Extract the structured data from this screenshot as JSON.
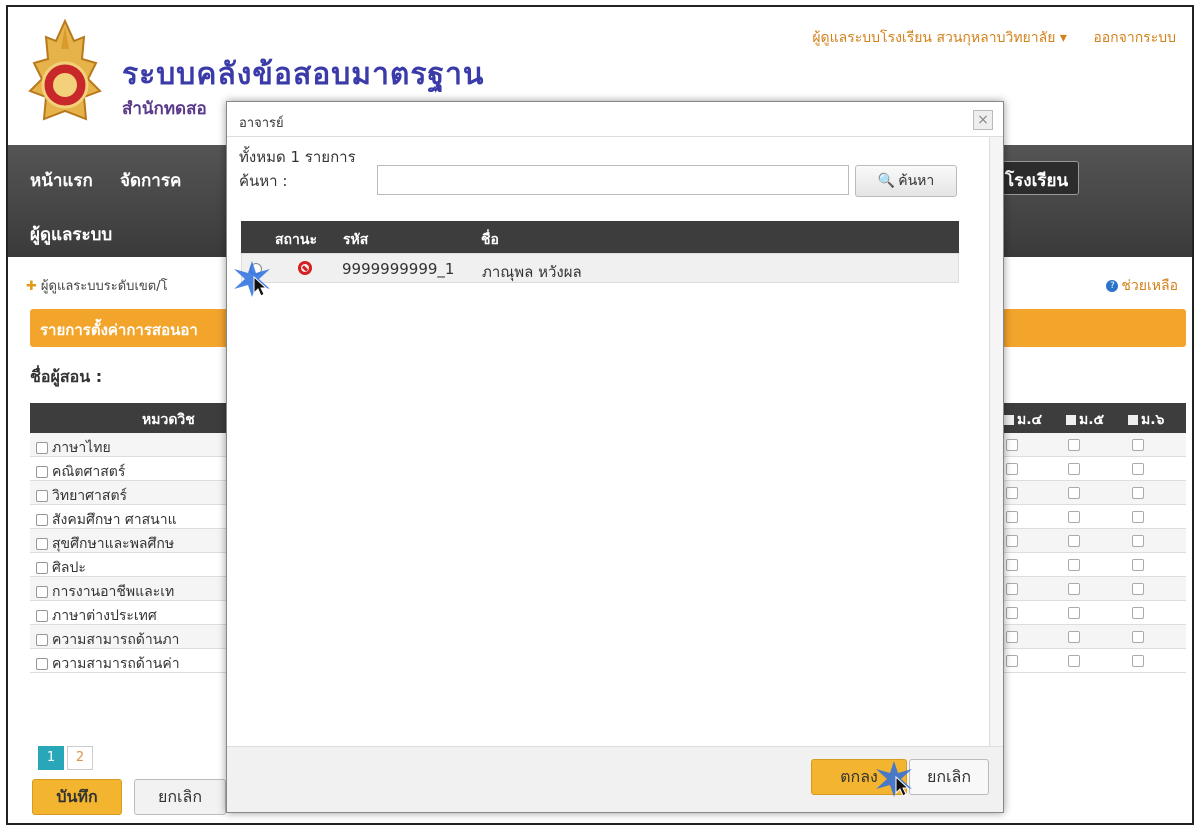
{
  "header": {
    "title": "ระบบคลังข้อสอบมาตรฐาน",
    "subtitle": "สำนักทดสอ",
    "user_menu": "ผู้ดูแลระบบโรงเรียน สวนกุหลาบวิทยาลัย ▾",
    "logout": "ออกจากระบบ"
  },
  "nav": {
    "items": [
      "หน้าแรก",
      "จัดการค",
      "ผู้ดูแลระบบ"
    ],
    "school_button": "โรงเรียน"
  },
  "breadcrumb": "ผู้ดูแลระบบระดับเขต/โ",
  "help": "ช่วยเหลือ",
  "section_title": "รายการตั้งค่าการสอนอา",
  "teacher_label": "ชื่อผู้สอน :",
  "grid": {
    "subject_header": "หมวดวิช",
    "level_headers": [
      "ม.๔",
      "ม.๕",
      "ม.๖"
    ],
    "rows": [
      "ภาษาไทย",
      "คณิตศาสตร์",
      "วิทยาศาสตร์",
      "สังคมศึกษา ศาสนาแ",
      "สุขศึกษาและพลศึกษ",
      "ศิลปะ",
      "การงานอาชีพและเท",
      "ภาษาต่างประเทศ",
      "ความสามารถด้านภา",
      "ความสามารถด้านค่า"
    ]
  },
  "pager": {
    "pages": [
      "1",
      "2"
    ],
    "active": "1"
  },
  "buttons": {
    "save": "บันทึก",
    "cancel": "ยกเลิก"
  },
  "modal": {
    "title": "อาจารย์",
    "close": "×",
    "total": "ทั้งหมด 1 รายการ",
    "search_label": "ค้นหา :",
    "search_value": "",
    "search_button": "ค้นหา",
    "columns": {
      "status": "สถานะ",
      "code": "รหัส",
      "name": "ชื่อ"
    },
    "rows": [
      {
        "code": "9999999999_1",
        "name": "ภาณุพล หวังผล"
      }
    ],
    "ok": "ตกลง",
    "cancel": "ยกเลิก"
  }
}
